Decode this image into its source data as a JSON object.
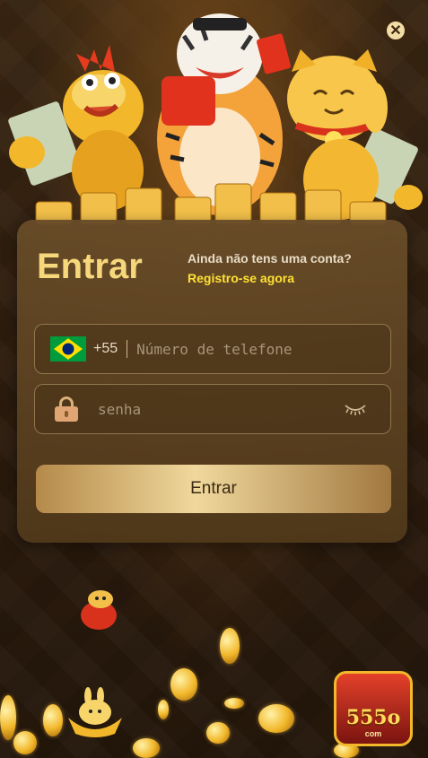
{
  "header": {
    "close_icon": "close-icon"
  },
  "login": {
    "title": "Entrar",
    "no_account_text": "Ainda não tens uma conta?",
    "register_link": "Registro-se agora",
    "phone": {
      "country_flag": "brazil-flag-icon",
      "country_code": "+55",
      "placeholder": "Número de telefone",
      "value": ""
    },
    "password": {
      "icon": "lock-icon",
      "placeholder": "senha",
      "value": "",
      "toggle_icon": "eye-closed-icon"
    },
    "submit_label": "Entrar"
  },
  "brand": {
    "logo_text": "555o",
    "logo_sub": "com"
  },
  "colors": {
    "title": "#f6d77b",
    "link": "#ffe135",
    "button_gold": "#f0d89c",
    "background": "#2a1a0e"
  }
}
